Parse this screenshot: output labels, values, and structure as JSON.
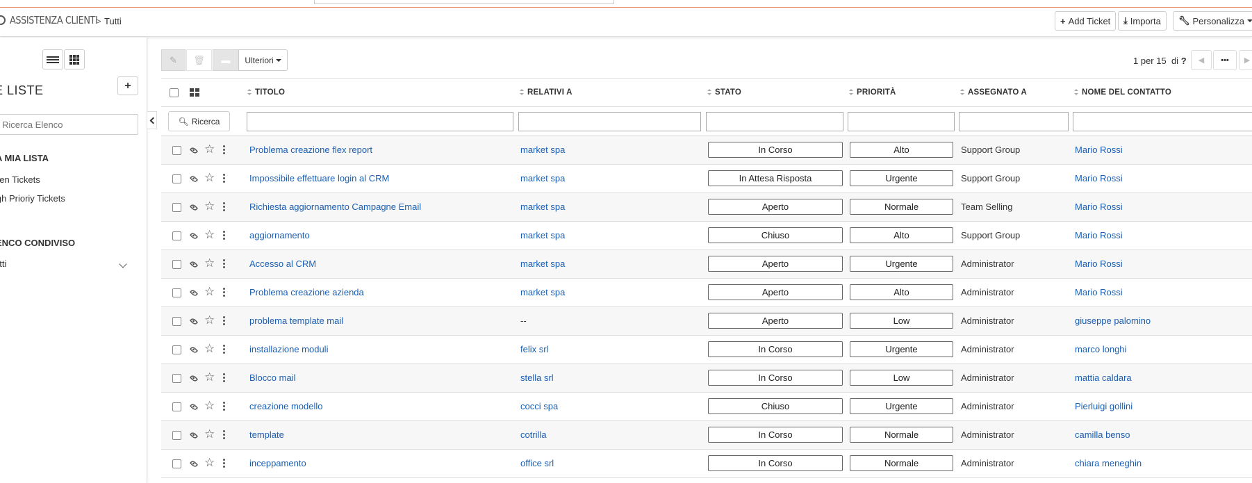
{
  "header": {
    "module_title": "ASSISTENZA CLIENTI",
    "breadcrumb_sep": ">",
    "breadcrumb_current": "Tutti",
    "add_ticket": "Add Ticket",
    "importa": "Importa",
    "personalizza": "Personalizza"
  },
  "sidebar": {
    "title": "E LISTE",
    "add_label": "+",
    "search_placeholder": "Ricerca Elenco",
    "my_list_title": "A MIA LISTA",
    "my_list_items": [
      "pen Tickets",
      "igh Prioriy Tickets"
    ],
    "shared_title": "ENCO CONDIVISO",
    "shared_items": [
      "utti"
    ]
  },
  "toolbar": {
    "more_label": "Ulteriori",
    "page_text": "1 per 15",
    "page_of": "di",
    "page_total": "?",
    "more_dots": "•••"
  },
  "table": {
    "columns": [
      "TITOLO",
      "RELATIVI A",
      "STATO",
      "PRIORITÀ",
      "ASSEGNATO A",
      "NOME DEL CONTATTO"
    ],
    "search_button": "Ricerca",
    "rows": [
      {
        "title": "Problema creazione flex report",
        "related": "market spa",
        "status": "In Corso",
        "priority": "Alto",
        "assigned": "Support Group",
        "contact": "Mario Rossi"
      },
      {
        "title": "Impossibile effettuare login al CRM",
        "related": "market spa",
        "status": "In Attesa Risposta",
        "priority": "Urgente",
        "assigned": "Support Group",
        "contact": "Mario Rossi"
      },
      {
        "title": "Richiesta aggiornamento Campagne Email",
        "related": "market spa",
        "status": "Aperto",
        "priority": "Normale",
        "assigned": "Team Selling",
        "contact": "Mario Rossi"
      },
      {
        "title": "aggiornamento",
        "related": "market spa",
        "status": "Chiuso",
        "priority": "Alto",
        "assigned": "Support Group",
        "contact": "Mario Rossi"
      },
      {
        "title": "Accesso al CRM",
        "related": "market spa",
        "status": "Aperto",
        "priority": "Urgente",
        "assigned": "Administrator",
        "contact": "Mario Rossi"
      },
      {
        "title": "Problema creazione azienda",
        "related": "market spa",
        "status": "Aperto",
        "priority": "Alto",
        "assigned": "Administrator",
        "contact": "Mario Rossi"
      },
      {
        "title": "problema template mail",
        "related": "--",
        "status": "Aperto",
        "priority": "Low",
        "assigned": "Administrator",
        "contact": "giuseppe palomino"
      },
      {
        "title": "installazione moduli",
        "related": "felix srl",
        "status": "In Corso",
        "priority": "Urgente",
        "assigned": "Administrator",
        "contact": "marco longhi"
      },
      {
        "title": "Blocco mail",
        "related": "stella srl",
        "status": "In Corso",
        "priority": "Low",
        "assigned": "Administrator",
        "contact": "mattia caldara"
      },
      {
        "title": "creazione modello",
        "related": "cocci spa",
        "status": "Chiuso",
        "priority": "Urgente",
        "assigned": "Administrator",
        "contact": "Pierluigi gollini"
      },
      {
        "title": "template",
        "related": "cotrilla",
        "status": "In Corso",
        "priority": "Normale",
        "assigned": "Administrator",
        "contact": "camilla benso"
      },
      {
        "title": "inceppamento",
        "related": "office srl",
        "status": "In Corso",
        "priority": "Normale",
        "assigned": "Administrator",
        "contact": "chiara meneghin"
      }
    ]
  },
  "colors": {
    "link": "#1a5fb4",
    "accent_line": "#e8875a"
  }
}
